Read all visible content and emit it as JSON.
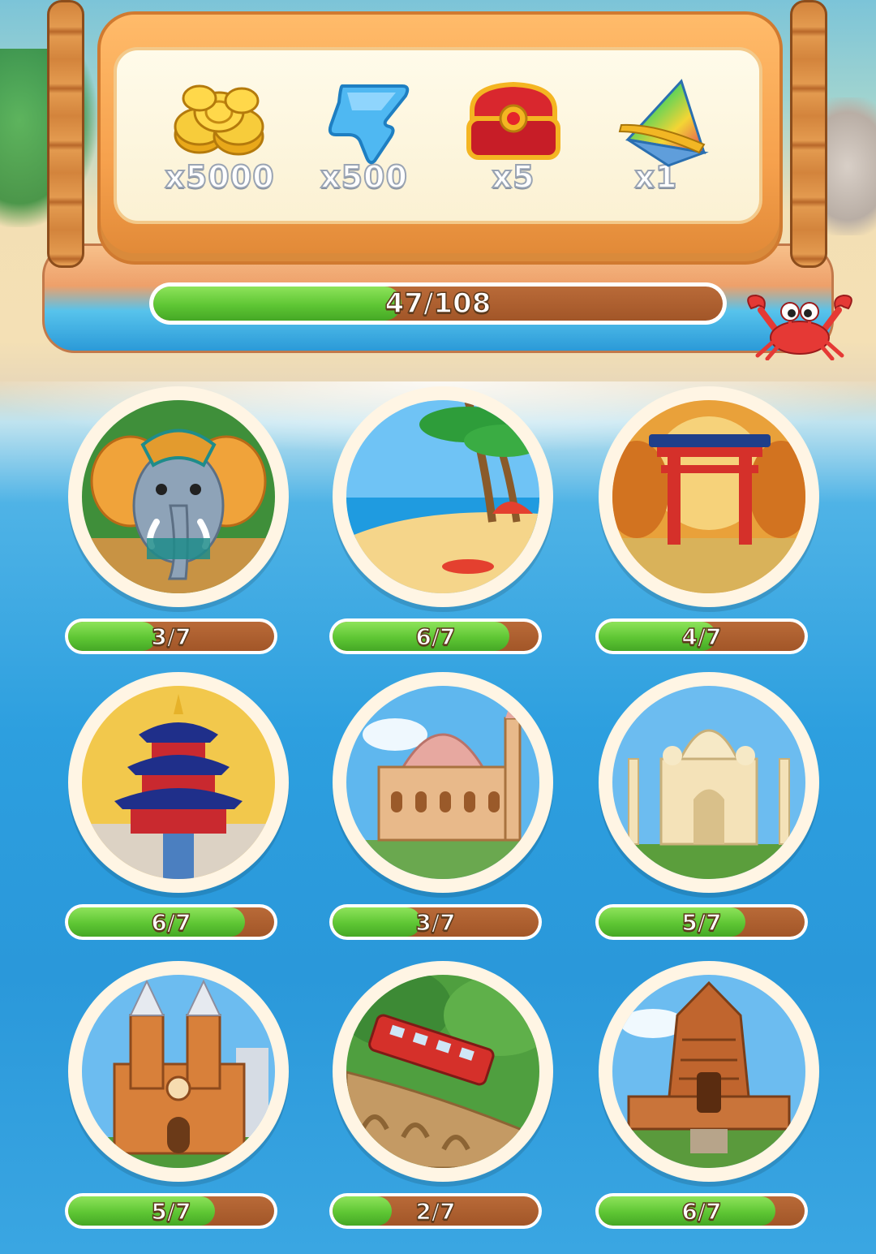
{
  "rewards": [
    {
      "name": "coins",
      "icon": "gold-coins-icon",
      "qty": "x5000"
    },
    {
      "name": "energy",
      "icon": "blue-bolt-icon",
      "qty": "x500"
    },
    {
      "name": "chest",
      "icon": "red-chest-icon",
      "qty": "x5"
    },
    {
      "name": "gem",
      "icon": "rainbow-gem-icon",
      "qty": "x1"
    }
  ],
  "main_progress": {
    "current": 47,
    "total": 108,
    "label": "47/108"
  },
  "destinations": [
    {
      "id": "elephant",
      "icon": "elephant-icon",
      "current": 3,
      "total": 7,
      "label": "3/7"
    },
    {
      "id": "beach",
      "icon": "beach-icon",
      "current": 6,
      "total": 7,
      "label": "6/7"
    },
    {
      "id": "torii",
      "icon": "torii-gate-icon",
      "current": 4,
      "total": 7,
      "label": "4/7"
    },
    {
      "id": "temple-of-heaven",
      "icon": "pagoda-icon",
      "current": 6,
      "total": 7,
      "label": "6/7"
    },
    {
      "id": "mosque",
      "icon": "mosque-icon",
      "current": 3,
      "total": 7,
      "label": "3/7"
    },
    {
      "id": "taj-mahal",
      "icon": "taj-mahal-icon",
      "current": 5,
      "total": 7,
      "label": "5/7"
    },
    {
      "id": "cathedral",
      "icon": "cathedral-icon",
      "current": 5,
      "total": 7,
      "label": "5/7"
    },
    {
      "id": "train",
      "icon": "train-icon",
      "current": 2,
      "total": 7,
      "label": "2/7"
    },
    {
      "id": "hindu-temple",
      "icon": "stone-temple-icon",
      "current": 6,
      "total": 7,
      "label": "6/7"
    }
  ],
  "colors": {
    "progress_fill": "#5ec634",
    "progress_track": "#a25628",
    "board": "#f6a14d",
    "ocean": "#2d9fdf"
  }
}
